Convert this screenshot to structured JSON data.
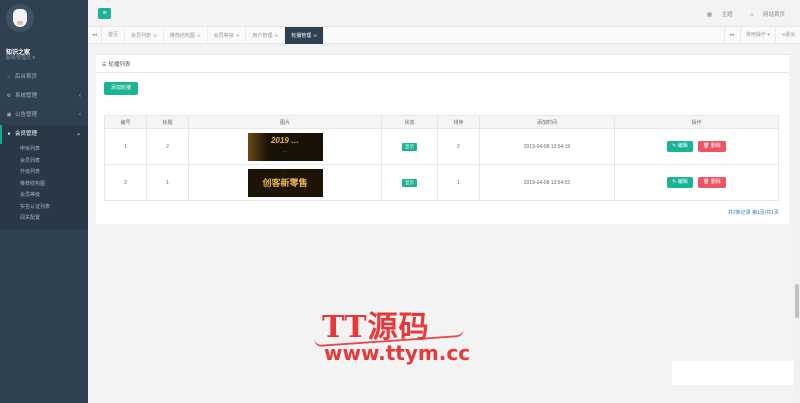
{
  "sidebar": {
    "profile": {
      "name": "知识之家",
      "role": "超级管理员 ▾"
    },
    "items": [
      {
        "icon": "home-icon",
        "label": "后台首页"
      },
      {
        "icon": "gear-icon",
        "label": "系统管理"
      },
      {
        "icon": "bell-icon",
        "label": "公告管理"
      },
      {
        "icon": "user-icon",
        "label": "会员管理"
      }
    ],
    "subitems": [
      "申诉列表",
      "会员列表",
      "升级列表",
      "推荐结构图",
      "会员等级",
      "实名认证列表",
      "闯关配置"
    ]
  },
  "topbar": {
    "menu_icon": "hamburger-icon",
    "theme_label": "主题",
    "site_label": "网站首页"
  },
  "tabs": {
    "items": [
      "首页",
      "会员列表",
      "推荐结构图",
      "会员等级",
      "用户管理",
      "轮播管理"
    ],
    "active": "轮播管理",
    "ops_label": "常用操作 ▾",
    "logout_label": "退出"
  },
  "panel": {
    "title": "轮播列表",
    "add_button": "添加轮播",
    "table": {
      "headers": [
        "编号",
        "标题",
        "图片",
        "状态",
        "排序",
        "添加时间",
        "操作"
      ],
      "rows": [
        {
          "id": "1",
          "title": "2",
          "status": "显示",
          "sort": "2",
          "time": "2019-04-08 12:54:19",
          "banner": {
            "t1": "2019 …",
            "t2": "…"
          }
        },
        {
          "id": "2",
          "title": "1",
          "status": "显示",
          "sort": "1",
          "time": "2019-04-08 12:54:02",
          "banner": {
            "t0": "…",
            "t1": "创客新零售",
            "t2": "…"
          }
        }
      ],
      "edit_label": "✎ 编辑",
      "delete_label": "🗑 删除"
    },
    "pager": "共2条记录 第1页/共1页"
  },
  "watermark": {
    "line1": "TT源码",
    "line2": "www.ttym.cc"
  },
  "colors": {
    "accent": "#1ab394",
    "danger": "#ed5565",
    "sidebar": "#2f4050",
    "watermark": "#e8393a"
  }
}
